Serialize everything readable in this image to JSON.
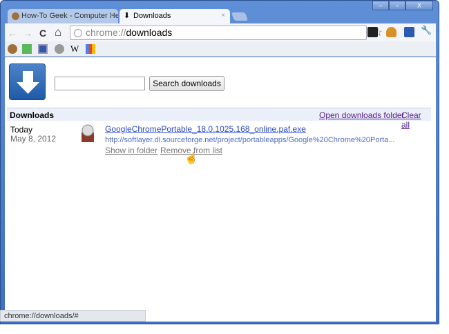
{
  "window": {
    "minimize": "‒",
    "maximize": "▫",
    "close": "X"
  },
  "tabs": [
    {
      "label": "How-To Geek - Computer Help"
    },
    {
      "label": "Downloads"
    }
  ],
  "tab_close": "×",
  "toolbar": {
    "back": "←",
    "forward": "→",
    "reload": "C",
    "home": "⌂",
    "url_scheme": "chrome://",
    "url_path": "downloads",
    "star": "☆",
    "wrench": "🔧"
  },
  "bookmarks": [
    "howtogeek",
    "download",
    "calculator",
    "globe",
    "wikipedia",
    "google"
  ],
  "bookmark_w": "W",
  "page": {
    "search_placeholder": "",
    "search_button": "Search downloads",
    "section_title": "Downloads",
    "open_folder": "Open downloads folder",
    "clear_all": "Clear all",
    "downloads": [
      {
        "day": "Today",
        "date": "May 8, 2012",
        "filename": "GoogleChromePortable_18.0.1025.168_online.paf.exe",
        "url": "http://softlayer.dl.sourceforge.net/project/portableapps/Google%20Chrome%20Porta...",
        "show_in_folder": "Show in folder",
        "remove": "Remove from list"
      }
    ]
  },
  "status_bar": "chrome://downloads/#"
}
